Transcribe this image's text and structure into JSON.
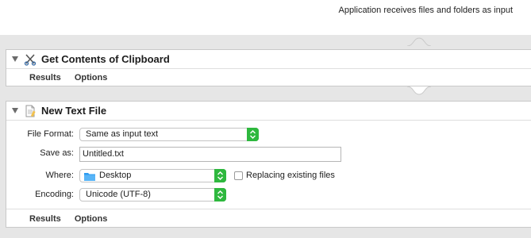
{
  "header": {
    "input_note": "Application receives files and folders as input"
  },
  "actions": [
    {
      "title": "Get Contents of Clipboard",
      "icon": "scissors-icon",
      "footer": {
        "results": "Results",
        "options": "Options"
      }
    },
    {
      "title": "New Text File",
      "icon": "text-document-icon",
      "fields": {
        "file_format": {
          "label": "File Format:",
          "value": "Same as input text"
        },
        "save_as": {
          "label": "Save as:",
          "value": "Untitled.txt"
        },
        "where": {
          "label": "Where:",
          "value": "Desktop",
          "icon": "folder-icon"
        },
        "replacing": {
          "label": "Replacing existing files",
          "checked": false
        },
        "encoding": {
          "label": "Encoding:",
          "value": "Unicode (UTF-8)"
        }
      },
      "footer": {
        "results": "Results",
        "options": "Options"
      }
    }
  ],
  "colors": {
    "stepper_green": "#2eb83e",
    "folder_blue": "#2d9bf0"
  }
}
